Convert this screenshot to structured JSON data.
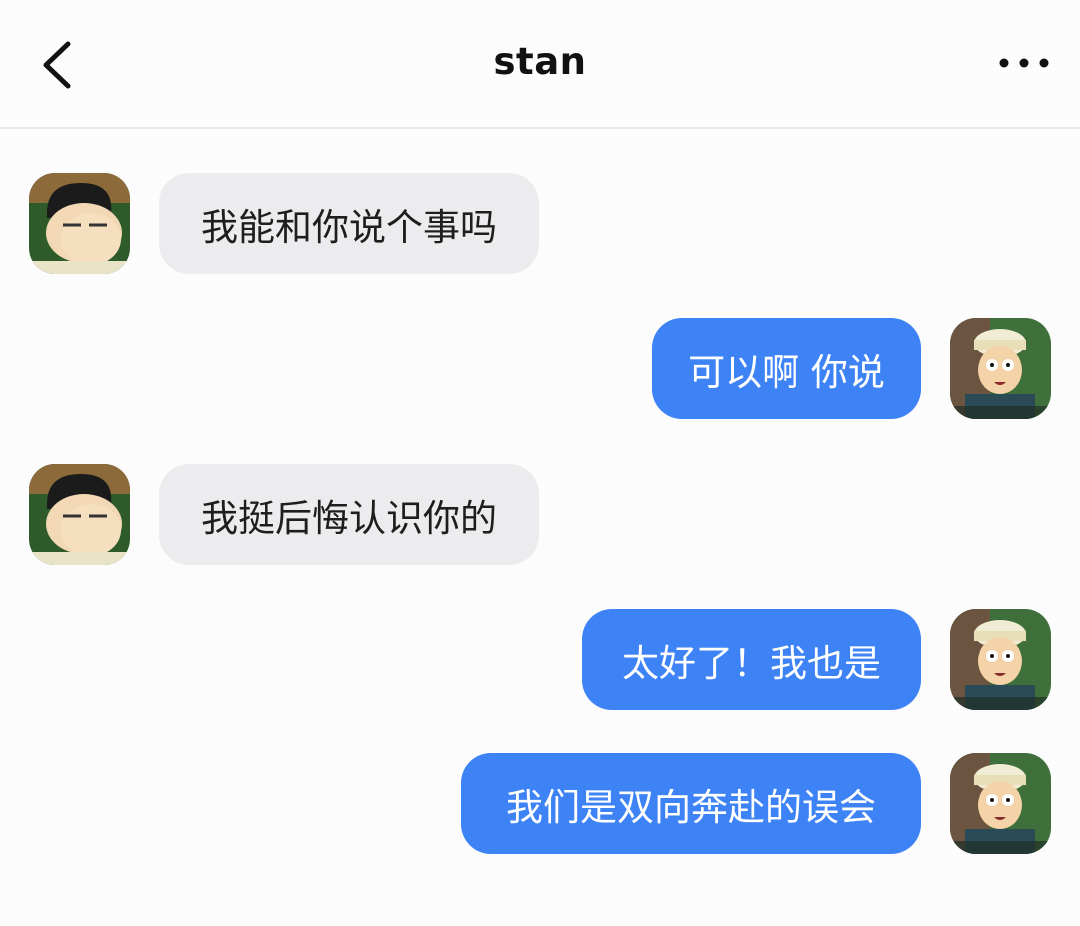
{
  "header": {
    "back_icon": "chevron-left-icon",
    "title": "stan",
    "more_icon": "more-horizontal-icon"
  },
  "messages": [
    {
      "side": "received",
      "sender_avatar": "avatar-dad",
      "text": "我能和你说个事吗"
    },
    {
      "side": "sent",
      "sender_avatar": "avatar-hat-guy",
      "text": "可以啊 你说"
    },
    {
      "side": "received",
      "sender_avatar": "avatar-dad",
      "text": "我挺后悔认识你的"
    },
    {
      "side": "sent",
      "sender_avatar": "avatar-hat-guy",
      "text": "太好了！我也是"
    },
    {
      "side": "sent",
      "sender_avatar": "avatar-hat-guy",
      "text": "我们是双向奔赴的误会"
    }
  ],
  "colors": {
    "sent_bubble": "#3d83f5",
    "received_bubble": "#ececee",
    "background": "#fcfcfd"
  }
}
